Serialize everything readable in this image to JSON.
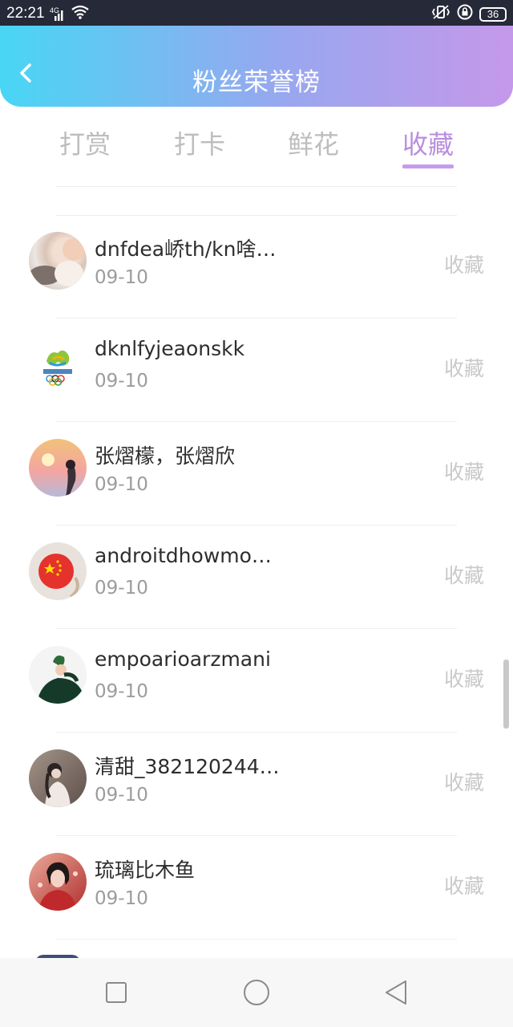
{
  "status_bar": {
    "time": "22:21",
    "network_type": "4G",
    "battery": "36"
  },
  "header": {
    "title": "粉丝荣誉榜"
  },
  "tabs": [
    {
      "label": "打赏"
    },
    {
      "label": "打卡"
    },
    {
      "label": "鲜花"
    },
    {
      "label": "收藏"
    }
  ],
  "active_tab": "收藏",
  "list": [
    {
      "name": "dnfdea峤th/kn啥…",
      "date": "09-10",
      "action": "收藏"
    },
    {
      "name": "dknlfyjeaonskk",
      "date": "09-10",
      "action": "收藏"
    },
    {
      "name": "张熠檬，张熠欣",
      "date": "09-10",
      "action": "收藏"
    },
    {
      "name": "androitdhowmo…",
      "date": "09-10",
      "action": "收藏"
    },
    {
      "name": "empoarioarzmani",
      "date": "09-10",
      "action": "收藏"
    },
    {
      "name": "清甜_382120244…",
      "date": "09-10",
      "action": "收藏"
    },
    {
      "name": "琉璃比木鱼",
      "date": "09-10",
      "action": "收藏"
    }
  ],
  "icons": {
    "back": "back-arrow-icon",
    "nav_recent": "square-icon",
    "nav_home": "circle-icon",
    "nav_back": "triangle-back-icon"
  },
  "colors": {
    "header_gradient_start": "#48d6f5",
    "header_gradient_end": "#c598ea",
    "active_tab": "#b98ede",
    "inactive_tab": "#bdbdbd"
  }
}
